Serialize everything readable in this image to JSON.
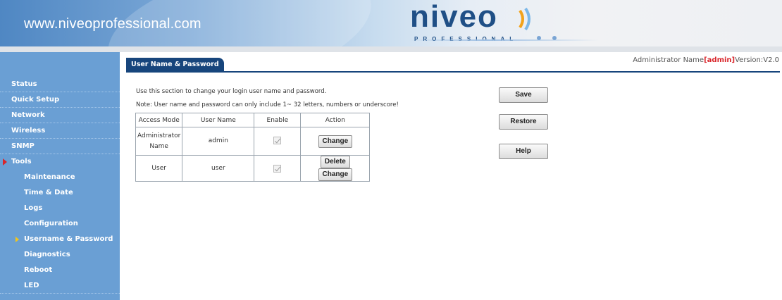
{
  "header": {
    "site_url": "www.niveoprofessional.com",
    "logo_text": "niveo",
    "logo_subtext": "PROFESSIONAL",
    "brand_color": "#1f4f86"
  },
  "sidebar": {
    "items": [
      {
        "label": "Status"
      },
      {
        "label": "Quick Setup"
      },
      {
        "label": "Network"
      },
      {
        "label": "Wireless"
      },
      {
        "label": "SNMP"
      },
      {
        "label": "Tools"
      }
    ],
    "tools_submenu": [
      {
        "label": "Maintenance"
      },
      {
        "label": "Time & Date"
      },
      {
        "label": "Logs"
      },
      {
        "label": "Configuration"
      },
      {
        "label": "Username & Password"
      },
      {
        "label": "Diagnostics"
      },
      {
        "label": "Reboot"
      },
      {
        "label": "LED"
      }
    ],
    "active_item": "Tools",
    "active_subitem": "Username & Password",
    "bg_color": "#6a9fd4"
  },
  "main": {
    "tab_label": "User Name & Password",
    "admin_label": "Administrator Name",
    "admin_name": "admin",
    "version_label": "Version:V2.0",
    "intro": "Use this section to change your login user name and password.",
    "note": "Note: User name and password can only include 1~ 32 letters, numbers or underscore!",
    "table": {
      "headers": [
        "Access Mode",
        "User Name",
        "Enable",
        "Action"
      ],
      "rows": [
        {
          "mode_line1": "Administrator",
          "mode_line2": "Name",
          "user": "admin",
          "enabled": true,
          "change": "Change"
        },
        {
          "mode": "User",
          "user": "user",
          "enabled": true,
          "delete": "Delete",
          "change": "Change"
        }
      ]
    },
    "buttons": {
      "save": "Save",
      "restore": "Restore",
      "help": "Help"
    }
  }
}
